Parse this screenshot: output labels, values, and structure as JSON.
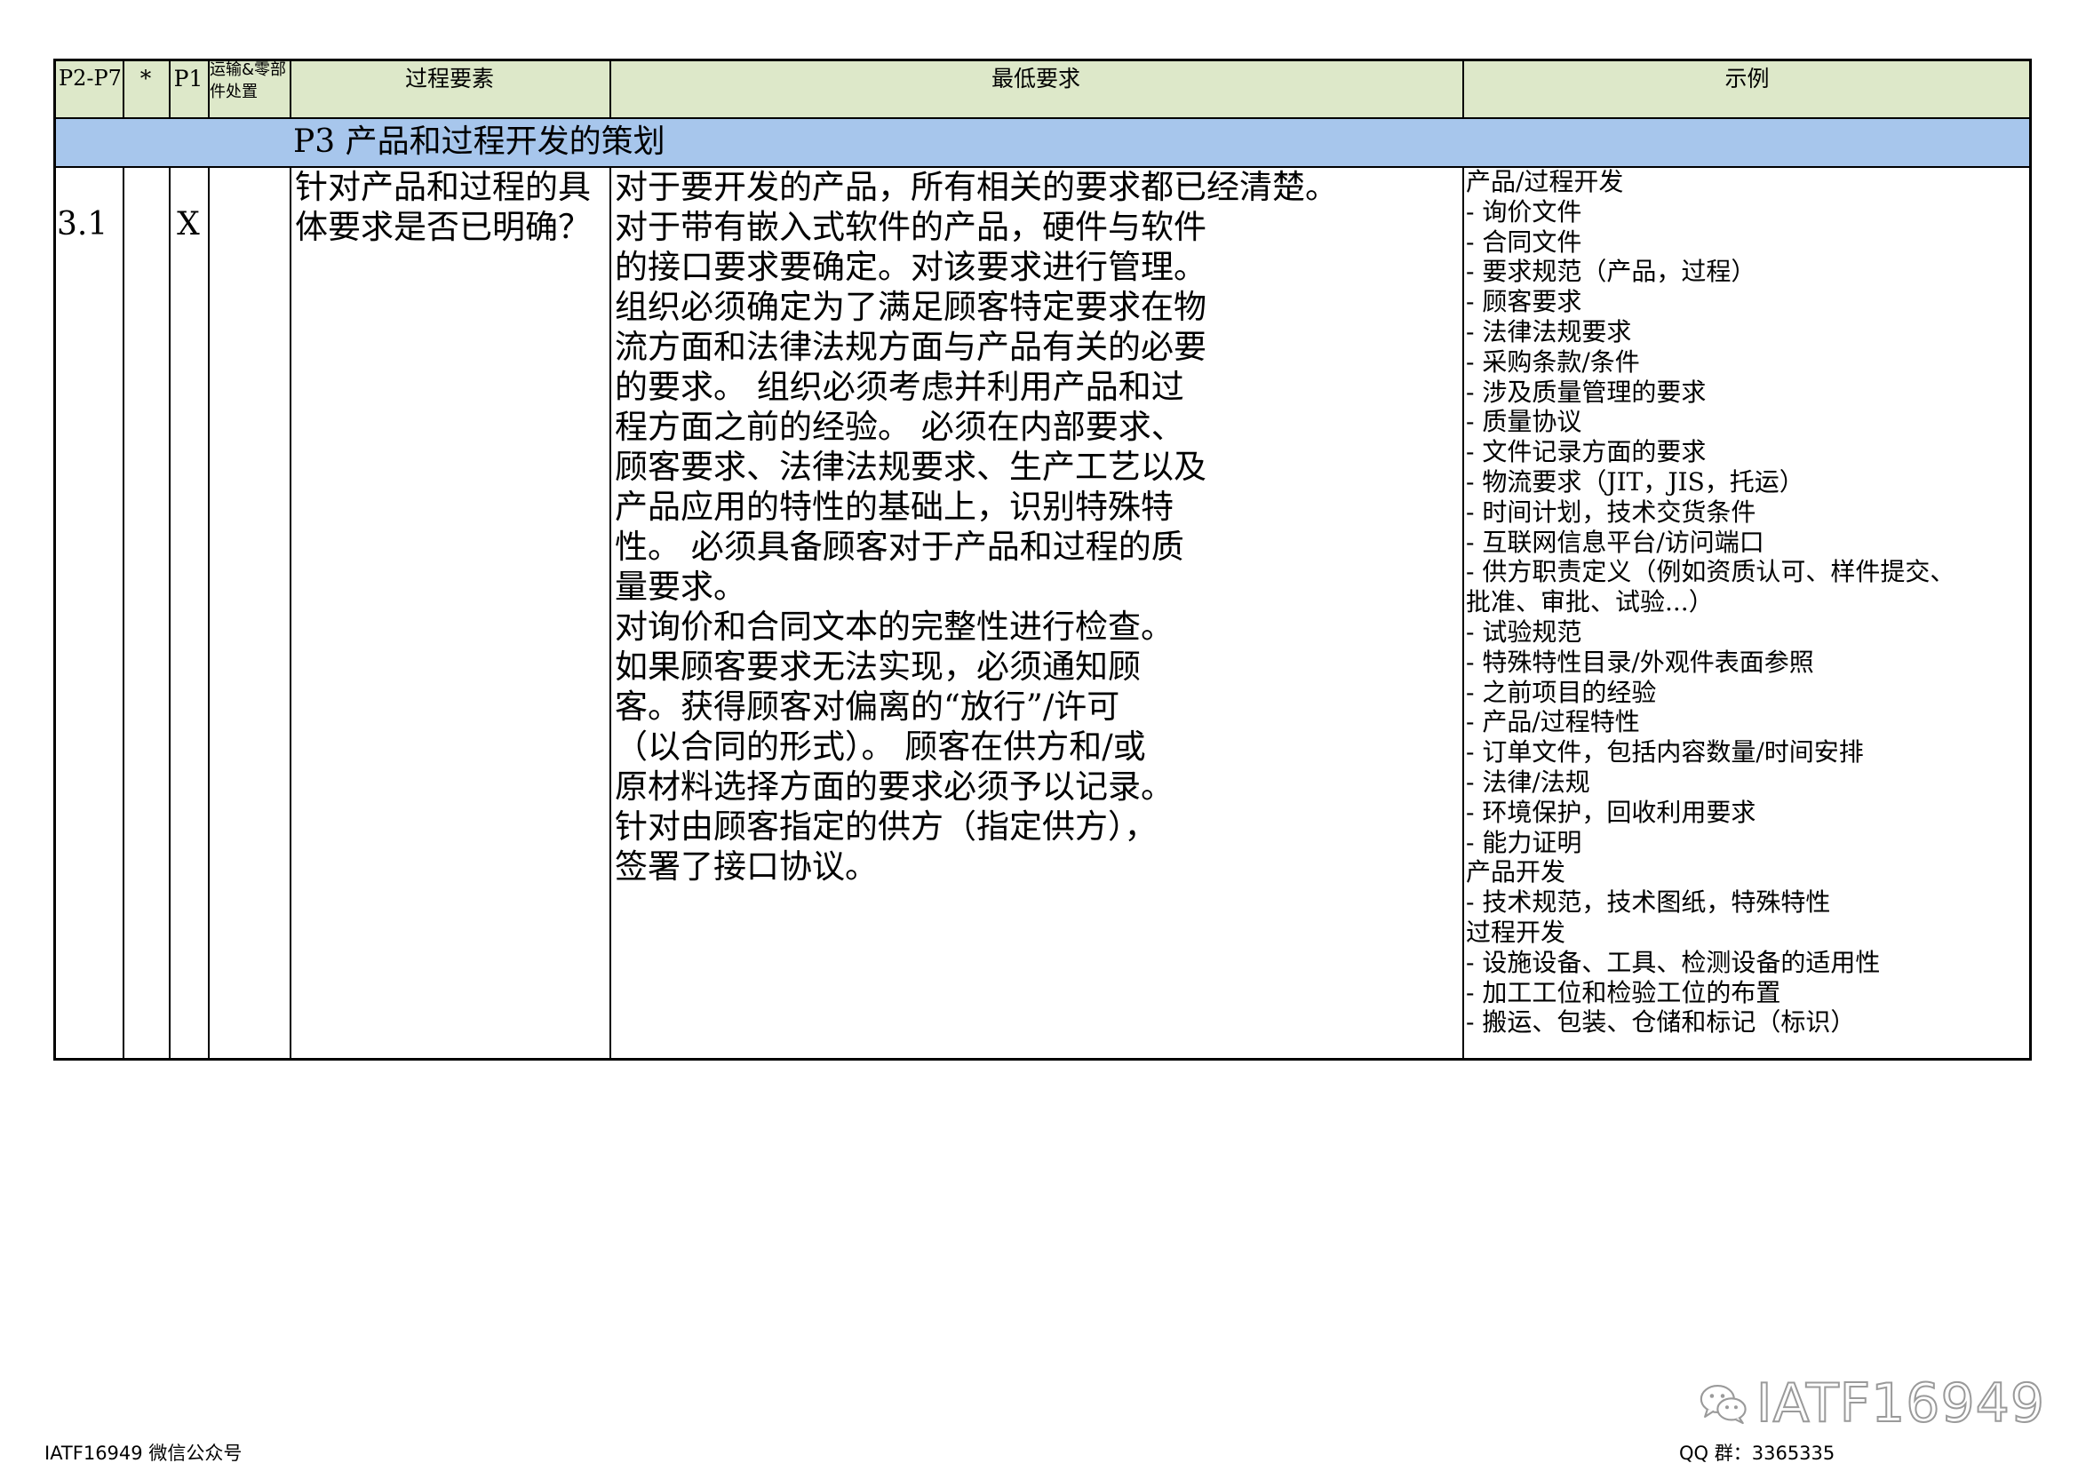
{
  "table": {
    "headers": {
      "col_p2p7": "P2-P7",
      "col_star": "*",
      "col_p1": "P1",
      "col_transport": "运输&零部件处置",
      "col_process": "过程要素",
      "col_min_req": "最低要求",
      "col_example": "示例"
    },
    "section": {
      "title": "P3 产品和过程开发的策划"
    },
    "rows": [
      {
        "number": "3.1",
        "star": "",
        "p1": "X",
        "transport": "",
        "process_element": "针对产品和过程的具体要求是否已明确？",
        "min_requirement": "对于要开发的产品，所有相关的要求都已经清楚。\n对于带有嵌入式软件的产品，硬件与软件\n的接口要求要确定。对该要求进行管理。\n组织必须确定为了满足顾客特定要求在物\n流方面和法律法规方面与产品有关的必要\n的要求。 组织必须考虑并利用产品和过\n程方面之前的经验。 必须在内部要求、\n顾客要求、法律法规要求、生产工艺以及\n产品应用的特性的基础上，识别特殊特\n性。 必须具备顾客对于产品和过程的质\n量要求。\n对询价和合同文本的完整性进行检查。\n如果顾客要求无法实现，必须通知顾\n客。获得顾客对偏离的“放行”/许可\n（以合同的形式）。 顾客在供方和/或\n原材料选择方面的要求必须予以记录。\n针对由顾客指定的供方（指定供方），\n签署了接口协议。",
        "examples": "产品/过程开发\n- 询价文件\n- 合同文件\n- 要求规范（产品，过程）\n- 顾客要求\n- 法律法规要求\n- 采购条款/条件\n- 涉及质量管理的要求\n- 质量协议\n- 文件记录方面的要求\n- 物流要求（JIT，JIS，托运）\n- 时间计划，技术交货条件\n- 互联网信息平台/访问端口\n- 供方职责定义（例如资质认可、样件提交、\n批准、审批、试验...）\n- 试验规范\n- 特殊特性目录/外观件表面参照\n- 之前项目的经验\n- 产品/过程特性\n- 订单文件，包括内容数量/时间安排\n- 法律/法规\n- 环境保护，回收利用要求\n- 能力证明\n产品开发\n- 技术规范，技术图纸，特殊特性\n过程开发\n- 设施设备、工具、检测设备的适用性\n- 加工工位和检验工位的布置\n- 搬运、包装、仓储和标记（标识）"
      }
    ]
  },
  "footer": {
    "left": "IATF16949 微信公众号",
    "right": "QQ 群：3365335",
    "watermark": "IATF16949",
    "watermark_icon": "wechat-icon"
  },
  "colors": {
    "header_bg": "#dde8c9",
    "section_bg": "#a7c6ec",
    "border": "#000000"
  }
}
